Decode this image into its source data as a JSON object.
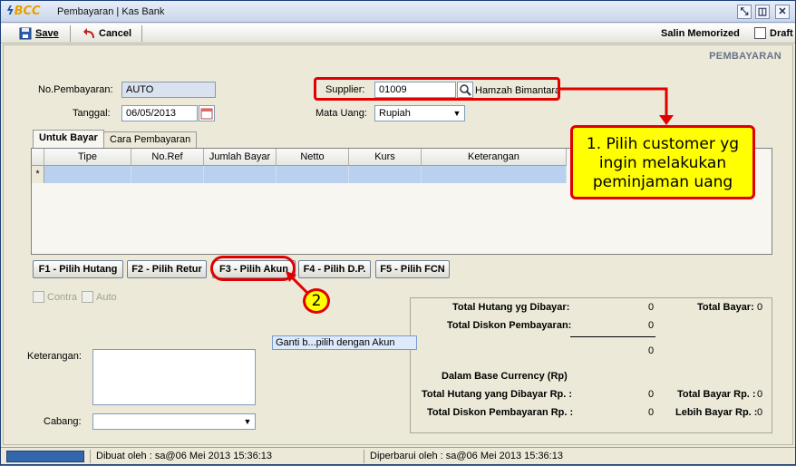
{
  "window": {
    "logo_text": "BCC",
    "title": "Pembayaran | Kas Bank",
    "controls": [
      "restore",
      "pin",
      "close"
    ]
  },
  "toolbar": {
    "save_label": "Save",
    "cancel_label": "Cancel",
    "salin_label": "Salin Memorized",
    "draft_label": "Draft",
    "draft_checked": false
  },
  "header": {
    "section_title": "PEMBAYARAN"
  },
  "form": {
    "no_pembayaran_label": "No.Pembayaran:",
    "no_pembayaran_value": "AUTO",
    "tanggal_label": "Tanggal:",
    "tanggal_value": "06/05/2013",
    "supplier_label": "Supplier:",
    "supplier_code": "01009",
    "supplier_name": "Hamzah Bimantara",
    "mata_uang_label": "Mata Uang:",
    "mata_uang_value": "Rupiah"
  },
  "tabs": [
    {
      "label": "Untuk Bayar",
      "active": true
    },
    {
      "label": "Cara Pembayaran",
      "active": false
    }
  ],
  "grid": {
    "columns": [
      "Tipe",
      "No.Ref",
      "Jumlah Bayar",
      "Netto",
      "Kurs",
      "Keterangan"
    ],
    "new_row_marker": "*"
  },
  "function_buttons": [
    "F1 - Pilih Hutang",
    "F2 - Pilih Retur",
    "F3 - Pilih Akun",
    "F4 - Pilih D.P.",
    "F5 - Pilih FCN"
  ],
  "options": {
    "contra_label": "Contra",
    "auto_label": "Auto"
  },
  "tooltip": {
    "text": "Ganti b...pilih dengan Akun"
  },
  "keterangan": {
    "label": "Keterangan:",
    "value": ""
  },
  "cabang": {
    "label": "Cabang:",
    "value": ""
  },
  "summary": {
    "total_hutang_label": "Total Hutang yg Dibayar:",
    "total_hutang_value": "0",
    "total_diskon_label": "Total Diskon Pembayaran:",
    "total_diskon_value": "0",
    "subtotal_value": "0",
    "total_bayar_label": "Total Bayar:",
    "total_bayar_value": "0",
    "base_currency_label": "Dalam Base Currency (Rp)",
    "total_hutang_rp_label": "Total Hutang yang Dibayar Rp. :",
    "total_hutang_rp_value": "0",
    "total_diskon_rp_label": "Total Diskon Pembayaran Rp. :",
    "total_diskon_rp_value": "0",
    "total_bayar_rp_label": "Total Bayar Rp. :",
    "total_bayar_rp_value": "0",
    "lebih_bayar_rp_label": "Lebih Bayar Rp. :",
    "lebih_bayar_rp_value": "0"
  },
  "status": {
    "dibuat": "Dibuat oleh : sa@06 Mei 2013  15:36:13",
    "diperbarui": "Diperbarui oleh : sa@06 Mei 2013  15:36:13"
  },
  "annotations": {
    "callout_1": "1. Pilih customer yg ingin melakukan peminjaman uang",
    "badge_2": "2"
  },
  "colors": {
    "callout_border": "#e00000",
    "callout_fill": "#ffff00",
    "readonly_field": "#d9e2ee",
    "grid_selected_row": "#b9d1ee"
  }
}
